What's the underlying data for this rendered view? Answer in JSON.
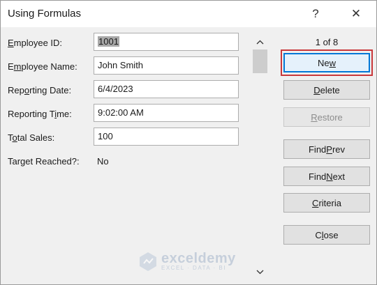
{
  "window": {
    "title": "Using Formulas",
    "help_glyph": "?",
    "close_glyph": "✕"
  },
  "fields": [
    {
      "label_pre": "",
      "label_key": "E",
      "label_post": "mployee ID:",
      "value": "1001"
    },
    {
      "label_pre": "E",
      "label_key": "m",
      "label_post": "ployee Name:",
      "value": "John Smith"
    },
    {
      "label_pre": "Rep",
      "label_key": "o",
      "label_post": "rting Date:",
      "value": "6/4/2023"
    },
    {
      "label_pre": "Reporting T",
      "label_key": "i",
      "label_post": "me:",
      "value": "9:02:00 AM"
    },
    {
      "label_pre": "T",
      "label_key": "o",
      "label_post": "tal Sales:",
      "value": "100"
    },
    {
      "label_pre": "Target Reached?:",
      "label_key": "",
      "label_post": "",
      "value": "No"
    }
  ],
  "record": {
    "counter": "1 of 8"
  },
  "buttons": {
    "new": {
      "pre": "Ne",
      "key": "w",
      "post": ""
    },
    "delete": {
      "pre": "",
      "key": "D",
      "post": "elete"
    },
    "restore": {
      "pre": "",
      "key": "R",
      "post": "estore"
    },
    "find_prev": {
      "pre": "Find ",
      "key": "P",
      "post": "rev"
    },
    "find_next": {
      "pre": "Find ",
      "key": "N",
      "post": "ext"
    },
    "criteria": {
      "pre": "",
      "key": "C",
      "post": "riteria"
    },
    "close": {
      "pre": "C",
      "key": "l",
      "post": "ose"
    }
  },
  "watermark": {
    "name": "exceldemy",
    "tagline": "EXCEL · DATA · BI"
  },
  "colors": {
    "highlight": "#c8373a",
    "default_button_border": "#0078d7"
  }
}
